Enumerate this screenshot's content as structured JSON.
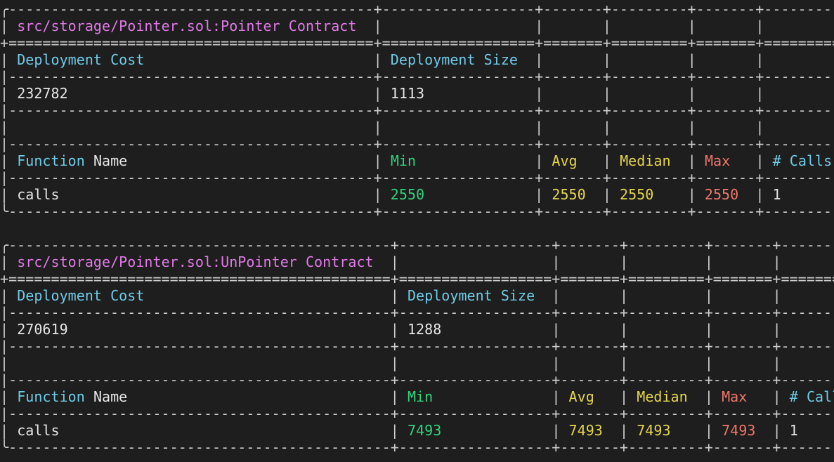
{
  "tables": [
    {
      "contract": "src/storage/Pointer.sol:Pointer",
      "contract_suffix": "Contract",
      "deployment_cost_label": "Deployment Cost",
      "deployment_size_label": "Deployment Size",
      "deployment_cost": "232782",
      "deployment_size": "1113",
      "headers": {
        "function_a": "Function",
        "function_b": "Name",
        "min": "Min",
        "avg": "Avg",
        "median": "Median",
        "max": "Max",
        "calls": "# Calls"
      },
      "rows": [
        {
          "name": "calls",
          "min": "2550",
          "avg": "2550",
          "median": "2550",
          "max": "2550",
          "calls": "1"
        }
      ]
    },
    {
      "contract": "src/storage/Pointer.sol:UnPointer",
      "contract_suffix": "Contract",
      "deployment_cost_label": "Deployment Cost",
      "deployment_size_label": "Deployment Size",
      "deployment_cost": "270619",
      "deployment_size": "1288",
      "headers": {
        "function_a": "Function",
        "function_b": "Name",
        "min": "Min",
        "avg": "Avg",
        "median": "Median",
        "max": "Max",
        "calls": "# Calls"
      },
      "rows": [
        {
          "name": "calls",
          "min": "7493",
          "avg": "7493",
          "median": "7493",
          "max": "7493",
          "calls": "1"
        }
      ]
    }
  ],
  "colors": {
    "background": "#1e1e1e",
    "title": "#e07ae6",
    "label": "#6fcbe8",
    "min": "#2fd47c",
    "avg_median": "#e6d64a",
    "max": "#f0766a"
  }
}
